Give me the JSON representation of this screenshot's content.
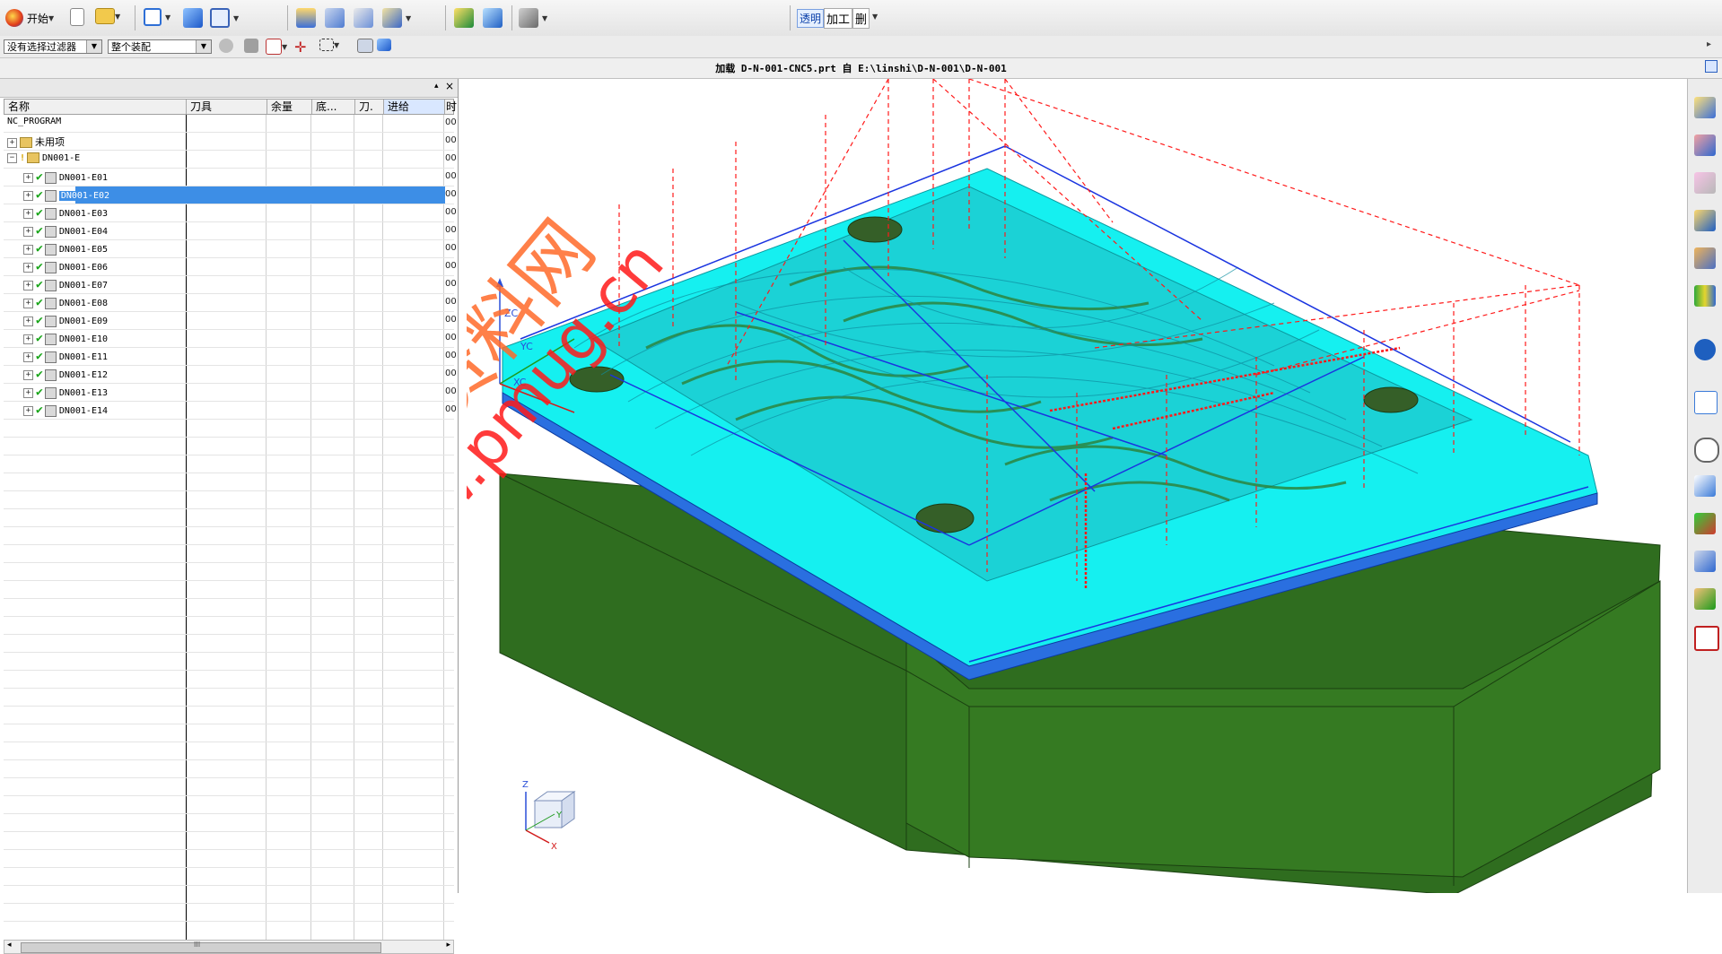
{
  "toolbar": {
    "start_label": "开始",
    "right_buttons": [
      "透明",
      "加工",
      "删"
    ]
  },
  "filters": {
    "selection_filter": "没有选择过滤器",
    "assembly_scope": "整个装配"
  },
  "window": {
    "title": "加载 D-N-001-CNC5.prt 自 E:\\linshi\\D-N-001\\D-N-001"
  },
  "navigator": {
    "columns": [
      "名称",
      "刀具",
      "余量",
      "底...",
      "刀.",
      "进给",
      "时"
    ],
    "root": "NC_PROGRAM",
    "unused": "未用项",
    "group": "DN001-E",
    "operations": [
      "DN001-E01",
      "DN001-E02",
      "DN001-E03",
      "DN001-E04",
      "DN001-E05",
      "DN001-E06",
      "DN001-E07",
      "DN001-E08",
      "DN001-E09",
      "DN001-E10",
      "DN001-E11",
      "DN001-E12",
      "DN001-E13",
      "DN001-E14"
    ],
    "selected_index": 1,
    "time_prefix": "00",
    "scrollbar_grip": "III"
  },
  "viewport": {
    "axis_labels": {
      "zc": "ZC",
      "yc": "YC",
      "xc": "XC"
    },
    "triad_labels": {
      "z": "Z",
      "y": "Y",
      "x": "X"
    },
    "watermark": {
      "cn": "编程资料网",
      "url": "www.pmug.cn"
    }
  },
  "colors": {
    "part_green": "#2f6d1f",
    "face_cyan": "#15f0f0",
    "toolpath_red": "#ff1a1a",
    "selection_blue": "#3d8ee6"
  }
}
